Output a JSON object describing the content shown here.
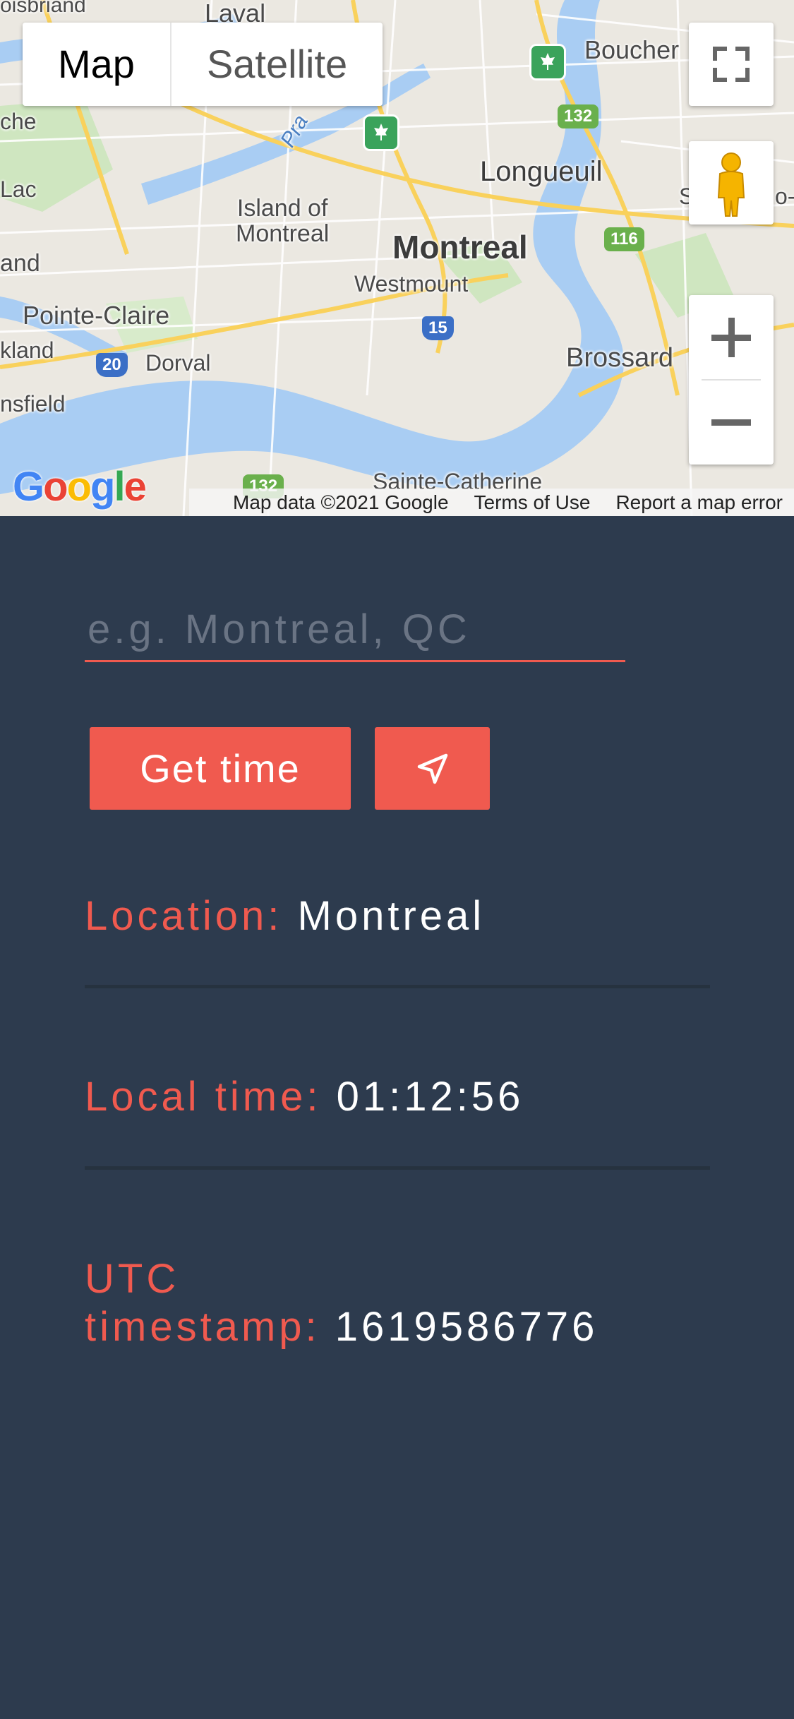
{
  "map": {
    "type_tabs": [
      "Map",
      "Satellite"
    ],
    "places": {
      "laval": "Laval",
      "boisbriand": "oisbriand",
      "boucherville": "Boucher",
      "longueuil": "Longueuil",
      "island": "Island of\nMontreal",
      "montreal": "Montreal",
      "westmount": "Westmount",
      "pointe_claire": "Pointe-Claire",
      "dorval": "Dorval",
      "brossard": "Brossard",
      "sainte_catherine": "Sainte-Catherine",
      "lac": "Lac",
      "che": "che",
      "and": "and",
      "kland": "kland",
      "nsfield": "nsfield",
      "river": "Pra",
      "right_edge": "S",
      "right_edge2": "o-c"
    },
    "shields": {
      "r132_top": "132",
      "r116": "116",
      "r15": "15",
      "r20": "20",
      "r132_bottom": "132"
    },
    "logo": "Google",
    "attribution": {
      "data": "Map data ©2021 Google",
      "terms": "Terms of Use",
      "report": "Report a map error"
    }
  },
  "search": {
    "placeholder": "e.g. Montreal, QC",
    "value": ""
  },
  "buttons": {
    "get_time": "Get time",
    "locate_icon": "navigation-arrow-icon"
  },
  "results": {
    "location_label": "Location:",
    "location_value": "Montreal",
    "local_time_label": "Local time:",
    "local_time_value": "01:12:56",
    "utc_label_line1": "UTC",
    "utc_label_line2": "timestamp:",
    "utc_value": "1619586776"
  },
  "colors": {
    "background": "#2d3b4e",
    "accent": "#f05a4f",
    "text": "#ffffff"
  }
}
